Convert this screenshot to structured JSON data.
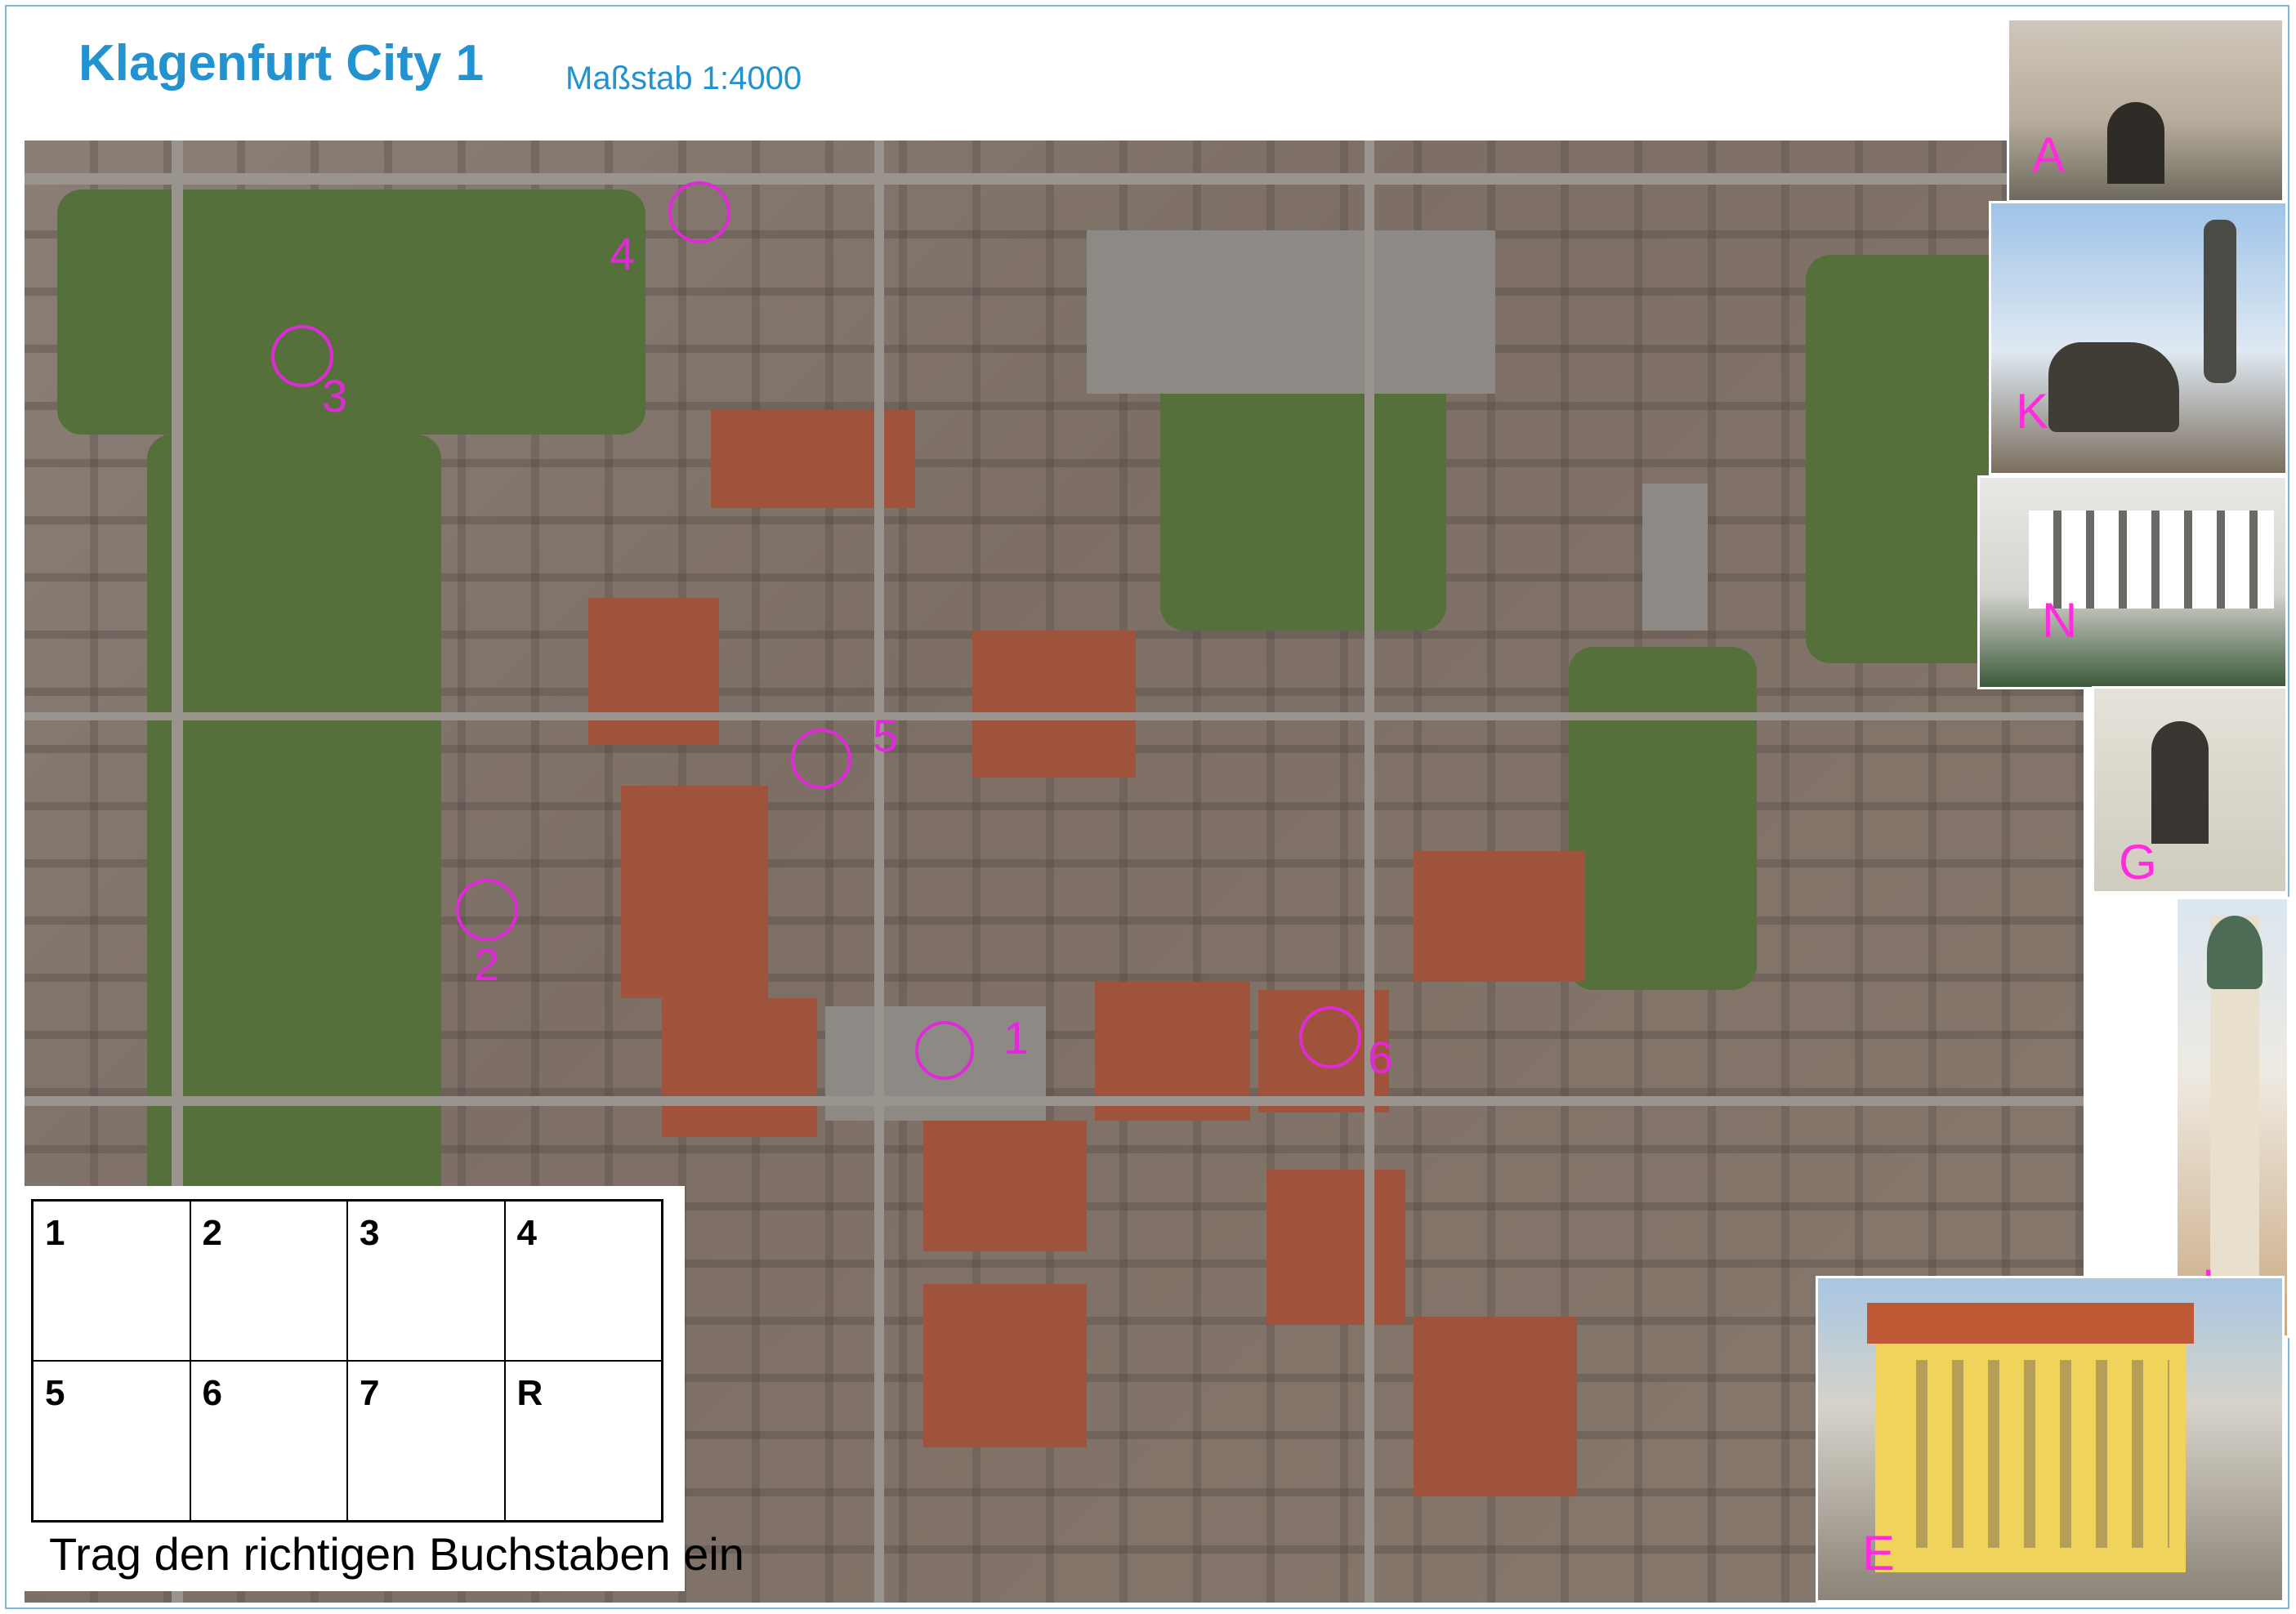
{
  "header": {
    "title": "Klagenfurt City 1",
    "scale": "Maßstab 1:4000"
  },
  "markers": [
    {
      "label": "1"
    },
    {
      "label": "2"
    },
    {
      "label": "3"
    },
    {
      "label": "4"
    },
    {
      "label": "5"
    },
    {
      "label": "6"
    }
  ],
  "photos": [
    {
      "letter": "A",
      "subject": "gate-building"
    },
    {
      "letter": "K",
      "subject": "dragon-fountain"
    },
    {
      "letter": "N",
      "subject": "arcade-courtyard"
    },
    {
      "letter": "G",
      "subject": "arched-doorway"
    },
    {
      "letter": "L",
      "subject": "church-tower"
    },
    {
      "letter": "E",
      "subject": "yellow-building"
    }
  ],
  "answer_grid": {
    "cells": [
      "1",
      "2",
      "3",
      "4",
      "5",
      "6",
      "7",
      "R"
    ]
  },
  "instruction": "Trag den richtigen Buchstaben ein",
  "colors": {
    "title": "#2292d0",
    "marker": "#e02ad8",
    "photo_letter": "#ff2bdc"
  }
}
